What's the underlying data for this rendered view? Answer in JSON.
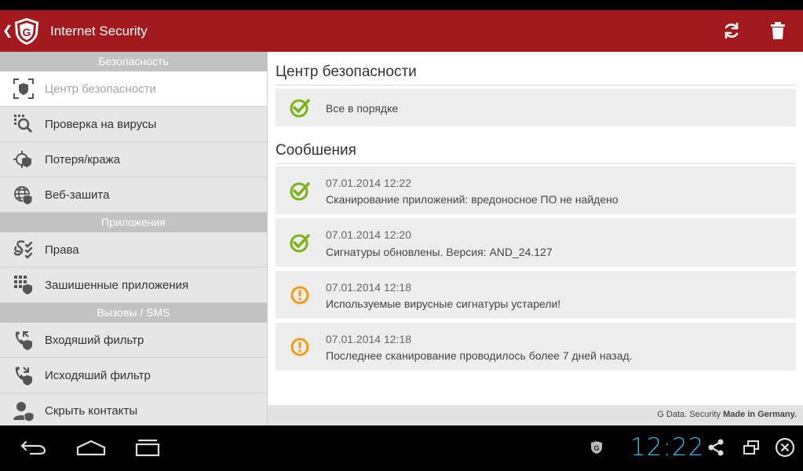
{
  "app": {
    "title": "Internet Security"
  },
  "sidebar": {
    "sections": [
      {
        "header": "Безопасность",
        "items": [
          {
            "label": "Центр безопасности",
            "icon": "security-center-icon"
          },
          {
            "label": "Проверка на вирусы",
            "icon": "virus-scan-icon"
          },
          {
            "label": "Потеря/кража",
            "icon": "loss-theft-icon"
          },
          {
            "label": "Веб-зашита",
            "icon": "web-protection-icon"
          }
        ]
      },
      {
        "header": "Приложения",
        "items": [
          {
            "label": "Права",
            "icon": "permissions-icon"
          },
          {
            "label": "Зашишенные приложения",
            "icon": "protected-apps-icon"
          }
        ]
      },
      {
        "header": "Вызовы / SMS",
        "items": [
          {
            "label": "Входяший фильтр",
            "icon": "incoming-filter-icon"
          },
          {
            "label": "Исходяший фильтр",
            "icon": "outgoing-filter-icon"
          },
          {
            "label": "Скрыть контакты",
            "icon": "hide-contacts-icon"
          }
        ]
      }
    ]
  },
  "main": {
    "security_title": "Центр безопасности",
    "status_text": "Все в порядке",
    "messages_title": "Сообшения",
    "messages": [
      {
        "date": "07.01.2014 12:22",
        "text": "Сканирование приложений: вредоносное ПО не найдено",
        "status": "ok"
      },
      {
        "date": "07.01.2014 12:20",
        "text": "Сигнатуры обновлены. Версия: AND_24.127",
        "status": "ok"
      },
      {
        "date": "07.01.2014 12:18",
        "text": "Используемые вирусные сигнатуры устарели!",
        "status": "warning"
      },
      {
        "date": "07.01.2014 12:18",
        "text": "Последнее сканирование проводилось более 7 дней назад.",
        "status": "warning"
      }
    ]
  },
  "footer": {
    "brand": "G Data. Security",
    "tagline": "Made in Germany."
  },
  "systembar": {
    "time": "12:22"
  },
  "colors": {
    "accent": "#a3191d",
    "ok": "#7ab317",
    "warning": "#f39c12",
    "clock": "#33b5e5"
  }
}
